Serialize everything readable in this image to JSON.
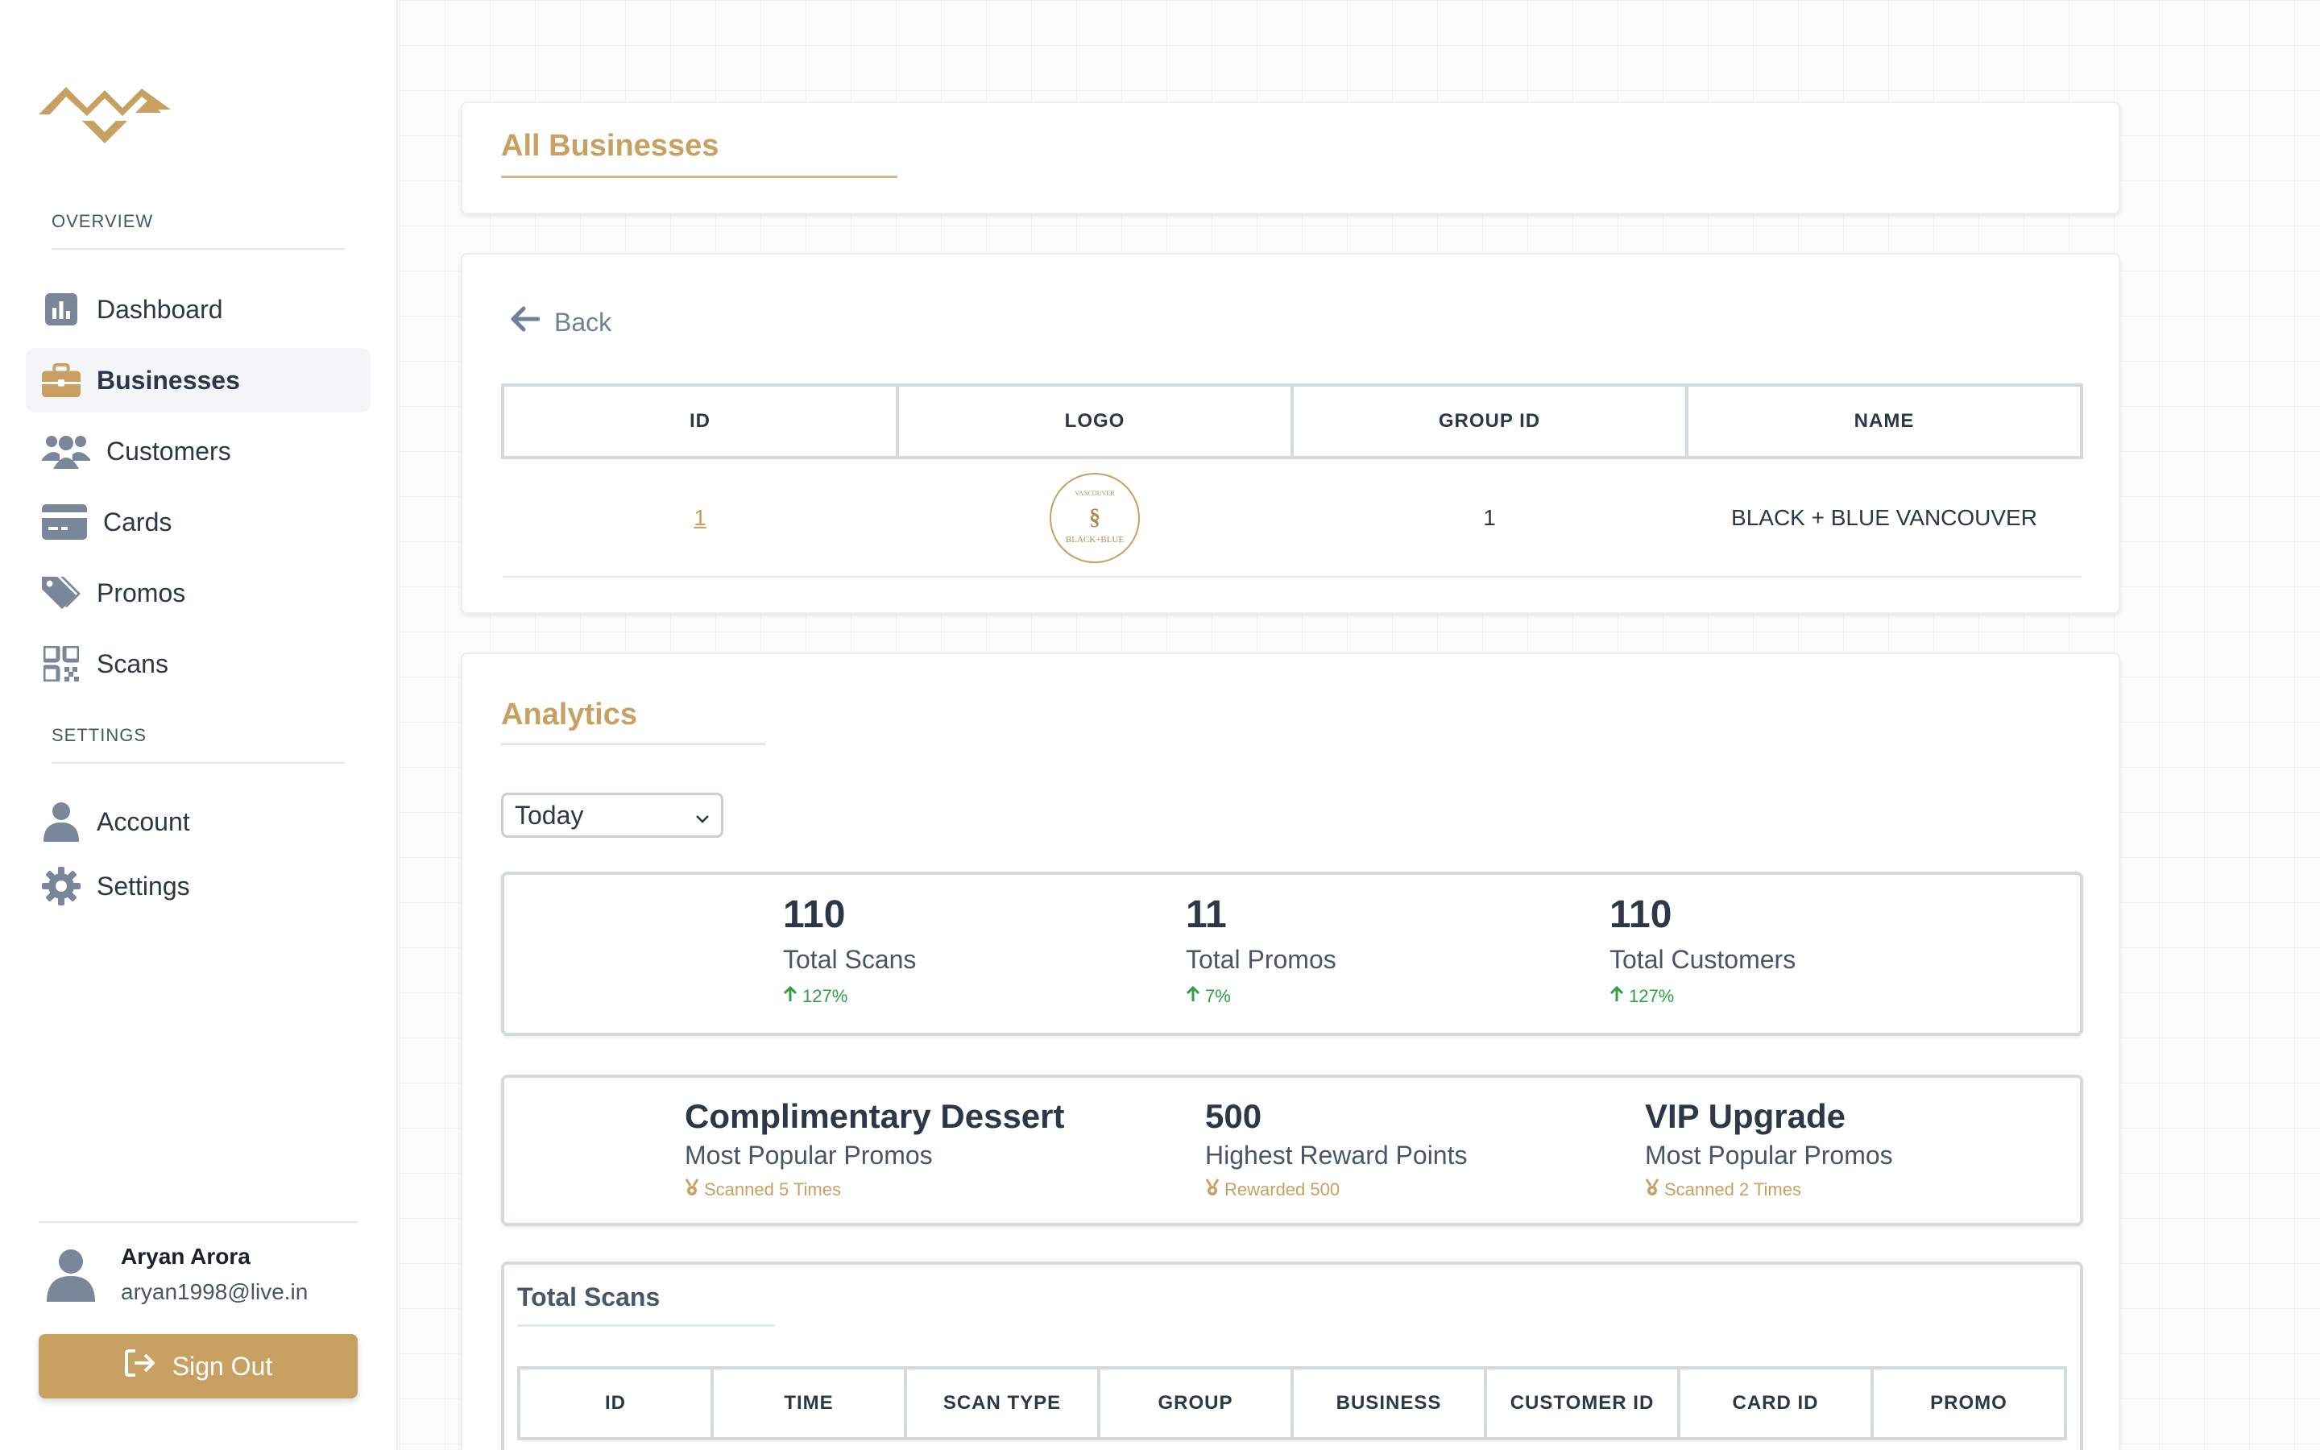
{
  "sidebar": {
    "overview_label": "OVERVIEW",
    "settings_label": "SETTINGS",
    "items": [
      {
        "label": "Dashboard"
      },
      {
        "label": "Businesses"
      },
      {
        "label": "Customers"
      },
      {
        "label": "Cards"
      },
      {
        "label": "Promos"
      },
      {
        "label": "Scans"
      }
    ],
    "settings_items": [
      {
        "label": "Account"
      },
      {
        "label": "Settings"
      }
    ],
    "user": {
      "name": "Aryan Arora",
      "email": "aryan1998@live.in"
    },
    "signout_label": "Sign Out"
  },
  "header": {
    "title": "All Businesses"
  },
  "business": {
    "back_label": "Back",
    "columns": [
      "ID",
      "LOGO",
      "GROUP ID",
      "NAME"
    ],
    "row": {
      "id": "1",
      "group_id": "1",
      "name": "BLACK + BLUE VANCOUVER",
      "logo_text_top": "VANCOUVER",
      "logo_text_bottom": "BLACK+BLUE"
    }
  },
  "analytics": {
    "title": "Analytics",
    "period": "Today",
    "stats": [
      {
        "value": "110",
        "label": "Total Scans",
        "change": "127%"
      },
      {
        "value": "11",
        "label": "Total Promos",
        "change": "7%"
      },
      {
        "value": "110",
        "label": "Total Customers",
        "change": "127%"
      }
    ],
    "highlights": [
      {
        "value": "Complimentary Dessert",
        "label": "Most Popular Promos",
        "sub": "Scanned 5 Times"
      },
      {
        "value": "500",
        "label": "Highest Reward Points",
        "sub": "Rewarded 500"
      },
      {
        "value": "VIP Upgrade",
        "label": "Most Popular Promos",
        "sub": "Scanned 2 Times"
      }
    ]
  },
  "scans": {
    "title": "Total Scans",
    "columns": [
      "ID",
      "TIME",
      "SCAN TYPE",
      "GROUP",
      "BUSINESS",
      "CUSTOMER ID",
      "CARD ID",
      "PROMO"
    ]
  },
  "colors": {
    "accent": "#c8a062",
    "positive": "#2f9e44",
    "icon": "#7a869a"
  }
}
